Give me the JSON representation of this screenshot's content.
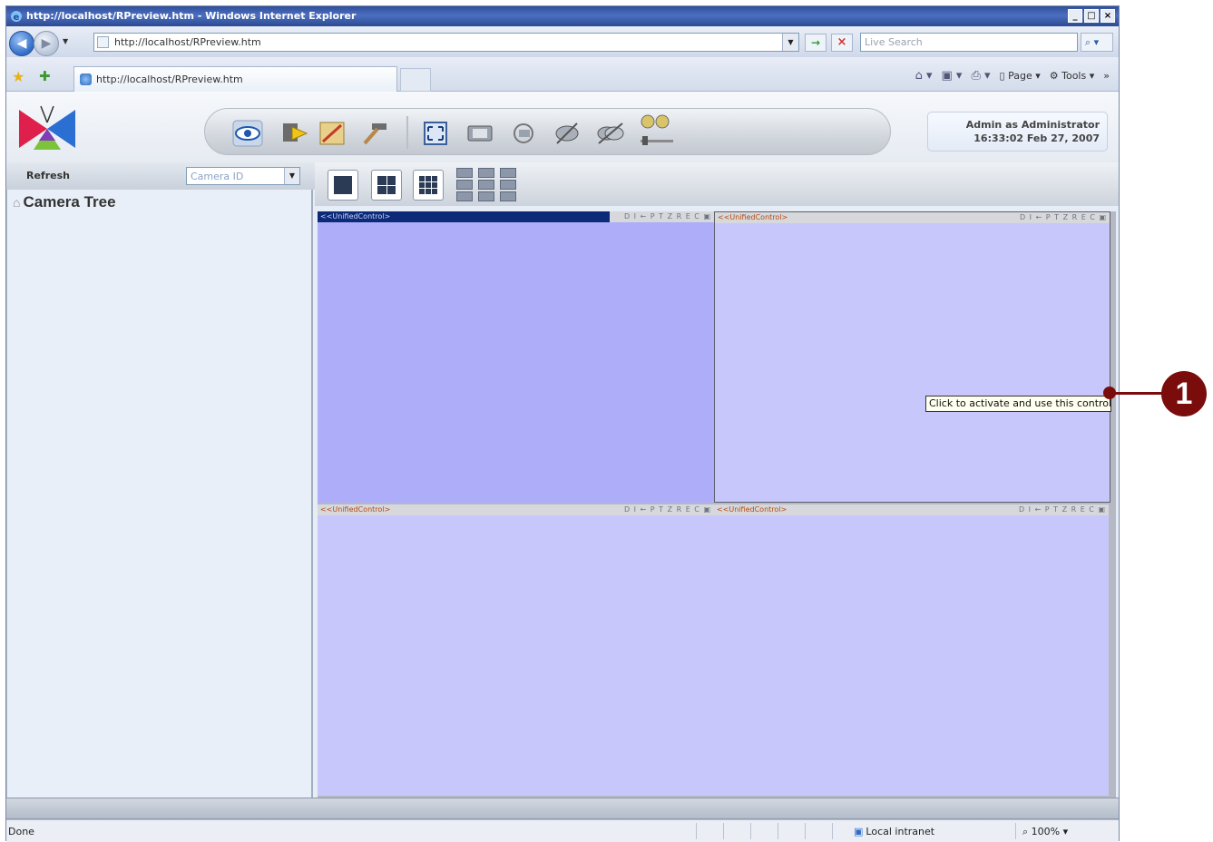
{
  "window": {
    "title": "http://localhost/RPreview.htm - Windows Internet Explorer",
    "controls": [
      "_",
      "□",
      "×"
    ]
  },
  "nav": {
    "back": "◀",
    "forward": "▶",
    "address": "http://localhost/RPreview.htm",
    "search_placeholder": "Live Search",
    "go": "→",
    "stop": "×",
    "search_btn": "⌕ ▾"
  },
  "tabs": {
    "current": "http://localhost/RPreview.htm"
  },
  "command_bar": {
    "page": "Page",
    "tools": "Tools",
    "more": "»"
  },
  "user": {
    "line1": "Admin as Administrator",
    "line2": "16:33:02 Feb 27, 2007"
  },
  "left": {
    "refresh": "Refresh",
    "camera_select_placeholder": "Camera ID",
    "tree_title": "Camera Tree"
  },
  "cells": [
    {
      "name": "<<UnifiedControl>",
      "controls": "D I ← P T Z R E C ▣",
      "active": true
    },
    {
      "name": "<<UnifiedControl>",
      "controls": "D I ← P T Z R E C ▣",
      "active": false
    },
    {
      "name": "<<UnifiedControl>",
      "controls": "D I ← P T Z R E C ▣",
      "active": false
    },
    {
      "name": "<<UnifiedControl>",
      "controls": "D I ← P T Z R E C ▣",
      "active": false
    }
  ],
  "tooltip": "Click to activate and use this control",
  "status": {
    "text": "Done",
    "zone": "Local intranet",
    "zoom": "100%"
  },
  "callout": "1",
  "colors": {
    "active_cell": "#adadf9",
    "inactive_cell": "#c7c7fc",
    "callout": "#7a0c0c"
  }
}
